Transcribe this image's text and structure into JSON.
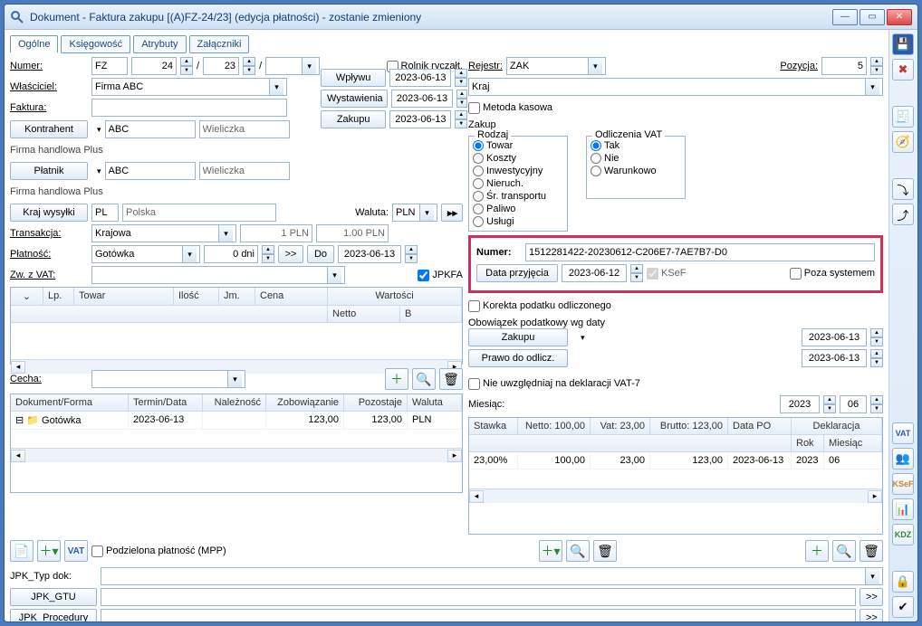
{
  "title": "Dokument - Faktura zakupu [(A)FZ-24/23] (edycja płatności) - zostanie zmieniony",
  "tabs": [
    "Ogólne",
    "Księgowość",
    "Atrybuty",
    "Załączniki"
  ],
  "left": {
    "numer_label": "Numer:",
    "numer_prefix": "FZ",
    "numer_1": "24",
    "numer_2": "23",
    "wlasciciel_label": "Właściciel:",
    "wlasciciel": "Firma ABC",
    "faktura_label": "Faktura:",
    "kontrahent_label": "Kontrahent",
    "kontrahent_kod": "ABC",
    "kontrahent_miasto": "Wieliczka",
    "kontrahent_nazwa": "Firma handlowa Plus",
    "platnik_label": "Płatnik",
    "platnik_kod": "ABC",
    "platnik_miasto": "Wieliczka",
    "platnik_nazwa": "Firma handlowa Plus",
    "kraj_wysylki_label": "Kraj wysyłki",
    "kraj_kod": "PL",
    "kraj_nazwa": "Polska",
    "waluta_label": "Waluta:",
    "waluta": "PLN",
    "transakcja_label": "Transakcja:",
    "transakcja": "Krajowa",
    "rate_left": "1 PLN",
    "rate_right": "1.00 PLN",
    "platnosc_label": "Płatność:",
    "platnosc": "Gotówka",
    "dni": "0 dni",
    "do_label": "Do",
    "do_date": "2023-06-13",
    "zw_vat_label": "Zw. z VAT:",
    "jpkfa_label": "JPKFA",
    "rolnik_label": "Rolnik ryczałt.",
    "btn_wplywu": "Wpływu",
    "date_wplywu": "2023-06-13",
    "btn_wystawienia": "Wystawienia",
    "date_wystawienia": "2023-06-13",
    "btn_zakupu": "Zakupu",
    "date_zakupu": "2023-06-13",
    "cecha_label": "Cecha:"
  },
  "right": {
    "rejestr_label": "Rejestr:",
    "rejestr": "ZAK",
    "pozycja_label": "Pozycja:",
    "pozycja": "5",
    "kraj": "Kraj",
    "metoda_kasowa": "Metoda kasowa",
    "zakup_title": "Zakup",
    "rodzaj_title": "Rodzaj",
    "rodzaj": [
      "Towar",
      "Koszty",
      "Inwestycyjny",
      "Nieruch.",
      "Śr. transportu",
      "Paliwo",
      "Usługi"
    ],
    "odliczenia_title": "Odliczenia VAT",
    "odliczenia": [
      "Tak",
      "Nie",
      "Warunkowo"
    ],
    "numer_label": "Numer:",
    "numer_val": "1512281422-20230612-C206E7-7AE7B7-D0",
    "data_przyjecia_btn": "Data przyjęcia",
    "data_przyjecia": "2023-06-12",
    "ksef_label": "KSeF",
    "poza_label": "Poza systemem",
    "korekta_label": "Korekta podatku odliczonego",
    "obowiazek_label": "Obowiązek podatkowy wg daty",
    "zakupu_btn": "Zakupu",
    "zakupu_date": "2023-06-13",
    "prawo_btn": "Prawo do odlicz.",
    "prawo_date": "2023-06-13",
    "nie_uwzgledniaj_label": "Nie uwzględniaj na deklaracji VAT-7",
    "miesiac_label": "Miesiąc:",
    "miesiac_rok": "2023",
    "miesiac_m": "06"
  },
  "items_grid": {
    "cols_top": [
      "Lp.",
      "Towar",
      "Ilość",
      "Jm.",
      "Cena"
    ],
    "cols_wartosci": "Wartości",
    "cols_sub": [
      "Netto",
      "B"
    ]
  },
  "pay_grid": {
    "cols": [
      "Dokument/Forma",
      "Termin/Data",
      "Należność",
      "Zobowiązanie",
      "Pozostaje",
      "Waluta"
    ],
    "row": {
      "forma": "Gotówka",
      "termin": "2023-06-13",
      "naleznosc": "",
      "zobow": "123,00",
      "pozostaje": "123,00",
      "waluta": "PLN"
    }
  },
  "vat_grid": {
    "cols": [
      "Stawka",
      "Netto: 100,00",
      "Vat: 23,00",
      "Brutto: 123,00",
      "Data PO"
    ],
    "dekl_head": "Deklaracja",
    "dekl_sub": [
      "Rok",
      "Miesiąc"
    ],
    "row": {
      "stawka": "23,00%",
      "netto": "100,00",
      "vat": "23,00",
      "brutto": "123,00",
      "datapo": "2023-06-13",
      "rok": "2023",
      "mies": "06"
    }
  },
  "bottom": {
    "mpp_label": "Podzielona płatność (MPP)",
    "jpk_typ_label": "JPK_Typ dok:",
    "jpk_gtu_btn": "JPK_GTU",
    "jpk_proc_btn": "JPK_Procedury"
  }
}
